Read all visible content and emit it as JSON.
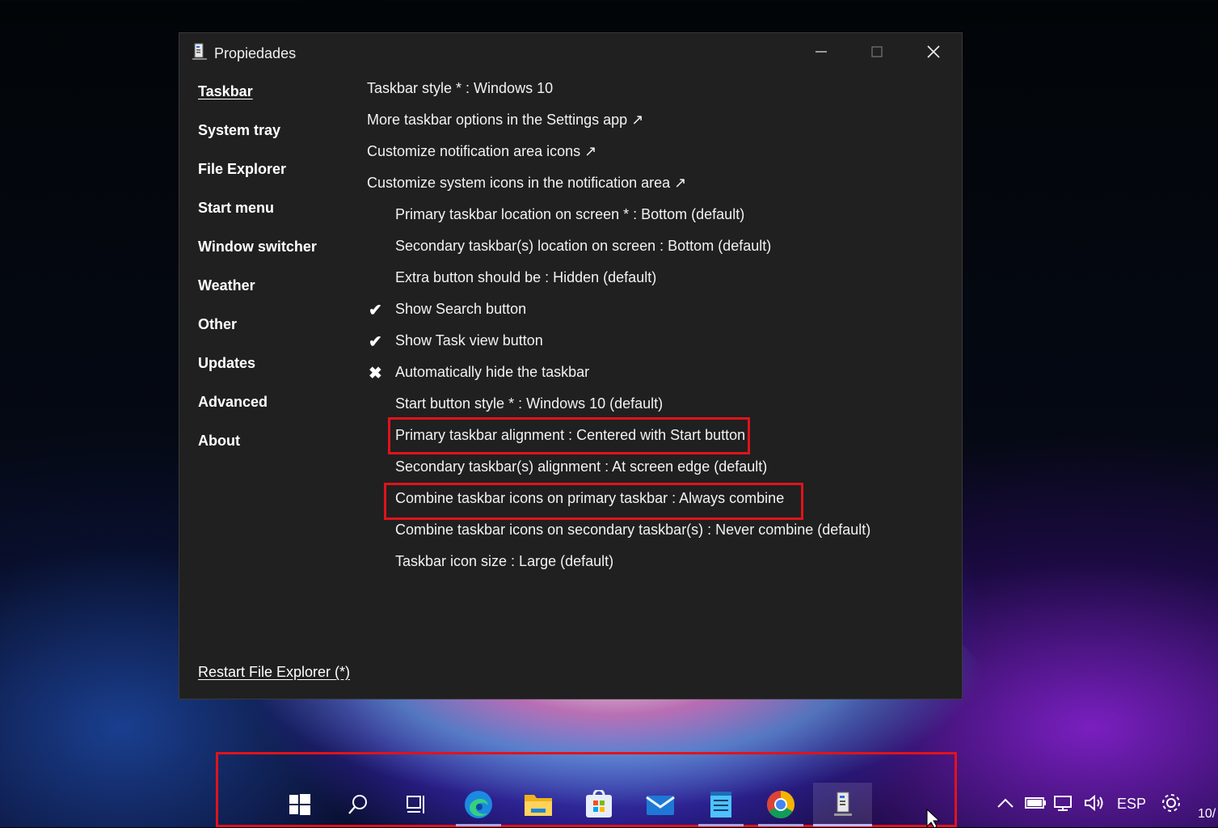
{
  "window": {
    "title": "Propiedades"
  },
  "sidebar": {
    "items": [
      {
        "label": "Taskbar",
        "active": true
      },
      {
        "label": "System tray"
      },
      {
        "label": "File Explorer"
      },
      {
        "label": "Start menu"
      },
      {
        "label": "Window switcher"
      },
      {
        "label": "Weather"
      },
      {
        "label": "Other"
      },
      {
        "label": "Updates"
      },
      {
        "label": "Advanced"
      },
      {
        "label": "About"
      }
    ],
    "restart_label": "Restart File Explorer (*)"
  },
  "settings": [
    {
      "text": "Taskbar style * : Windows 10"
    },
    {
      "text": "More taskbar options in the Settings app ↗"
    },
    {
      "text": "Customize notification area icons ↗"
    },
    {
      "text": "Customize system icons in the notification area ↗"
    },
    {
      "text": "Primary taskbar location on screen * : Bottom (default)"
    },
    {
      "text": "Secondary taskbar(s) location on screen : Bottom (default)"
    },
    {
      "text": "Extra button should be : Hidden (default)"
    },
    {
      "text": "Show Search button",
      "mark": "✔"
    },
    {
      "text": "Show Task view button",
      "mark": "✔"
    },
    {
      "text": "Automatically hide the taskbar",
      "mark": "✖"
    },
    {
      "text": "Start button style * : Windows 10 (default)"
    },
    {
      "text": "Primary taskbar alignment : Centered with Start button"
    },
    {
      "text": "Secondary taskbar(s) alignment : At screen edge (default)"
    },
    {
      "text": "Combine taskbar icons on primary taskbar : Always combine"
    },
    {
      "text": "Combine taskbar icons on secondary taskbar(s) : Never combine (default)"
    },
    {
      "text": "Taskbar icon size : Large (default)"
    }
  ],
  "taskbar": {
    "icons": [
      "start-icon",
      "search-icon",
      "task-view-icon",
      "edge-icon",
      "file-explorer-icon",
      "store-icon",
      "mail-icon",
      "notepad-icon",
      "chrome-icon",
      "properties-icon"
    ],
    "tray": {
      "language": "ESP",
      "clock_partial": "10/"
    }
  },
  "colors": {
    "highlight": "#e0131b",
    "window_bg": "#202020"
  }
}
